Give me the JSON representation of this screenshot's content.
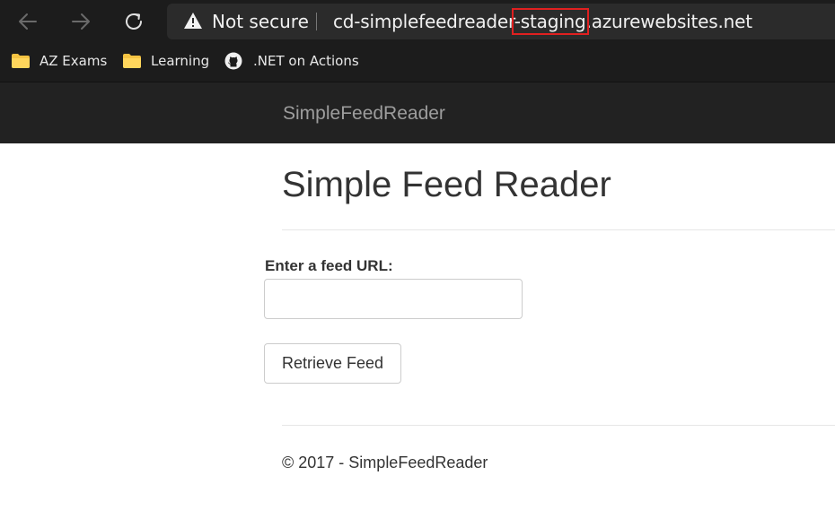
{
  "browser": {
    "security_label": "Not secure",
    "url_prefix": "cd-simplefeedreader",
    "url_highlight": "-staging",
    "url_suffix": ".azurewebsites.net",
    "icons": {
      "back": "back-arrow-icon",
      "forward": "forward-arrow-icon",
      "refresh": "refresh-icon",
      "warning": "warning-icon"
    },
    "highlight_color": "#e02020"
  },
  "bookmarks": [
    {
      "label": "AZ Exams",
      "icon": "folder-icon"
    },
    {
      "label": "Learning",
      "icon": "folder-icon"
    },
    {
      "label": ".NET on Actions",
      "icon": "github-icon"
    }
  ],
  "site": {
    "brand": "SimpleFeedReader",
    "title": "Simple Feed Reader",
    "form": {
      "label": "Enter a feed URL:",
      "input_value": "",
      "button_label": "Retrieve Feed"
    },
    "footer": "© 2017 - SimpleFeedReader"
  },
  "colors": {
    "navbar_bg": "#222222",
    "brand_text": "#9d9d9d",
    "folder": "#f5c342"
  }
}
